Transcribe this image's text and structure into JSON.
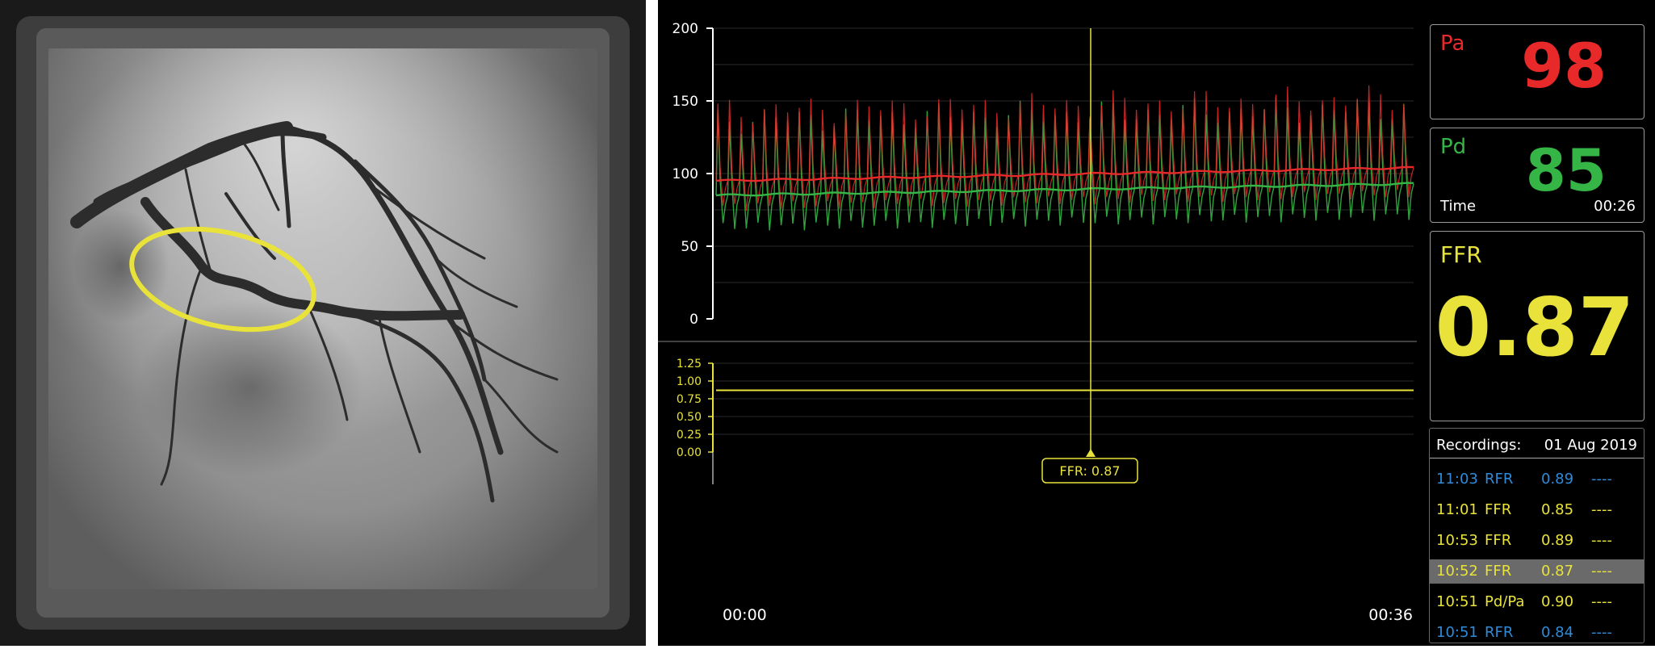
{
  "colors": {
    "pa": "#e8292a",
    "pd": "#35b545",
    "ffr": "#e8e23a",
    "rfr": "#2f8ad8",
    "axis": "#ffffff",
    "ffr_axis": "#e8e23a"
  },
  "pressure_chart": {
    "y_ticks": [
      "200",
      "150",
      "100",
      "50",
      "0"
    ],
    "ylim": [
      0,
      200
    ],
    "pa_baseline_start": 95,
    "pa_baseline_end": 104,
    "pd_baseline_start": 85,
    "pd_baseline_end": 93
  },
  "ratio_chart": {
    "y_ticks": [
      "1.25",
      "1.00",
      "0.75",
      "0.50",
      "0.25",
      "0.00"
    ],
    "ylim": [
      0,
      1.25
    ],
    "ffr_level": 0.87
  },
  "time_axis": {
    "start": "00:00",
    "end": "00:36"
  },
  "cursor": {
    "label": "FFR: 0.87"
  },
  "pa_panel": {
    "label": "Pa",
    "value": "98"
  },
  "pd_panel": {
    "label": "Pd",
    "value": "85",
    "time_label": "Time",
    "time_value": "00:26"
  },
  "ffr_panel": {
    "label": "FFR",
    "value": "0.87"
  },
  "recordings": {
    "header_label": "Recordings:",
    "header_date": "01 Aug 2019",
    "rows": [
      {
        "time": "11:03",
        "type": "RFR",
        "value": "0.89",
        "flag": "----",
        "color": "#2f8ad8",
        "selected": false
      },
      {
        "time": "11:01",
        "type": "FFR",
        "value": "0.85",
        "flag": "----",
        "color": "#e8e23a",
        "selected": false
      },
      {
        "time": "10:53",
        "type": "FFR",
        "value": "0.89",
        "flag": "----",
        "color": "#e8e23a",
        "selected": false
      },
      {
        "time": "10:52",
        "type": "FFR",
        "value": "0.87",
        "flag": "----",
        "color": "#e8e23a",
        "selected": true
      },
      {
        "time": "10:51",
        "type": "Pd/Pa",
        "value": "0.90",
        "flag": "----",
        "color": "#e8e23a",
        "selected": false
      },
      {
        "time": "10:51",
        "type": "RFR",
        "value": "0.84",
        "flag": "----",
        "color": "#2f8ad8",
        "selected": false
      }
    ]
  }
}
